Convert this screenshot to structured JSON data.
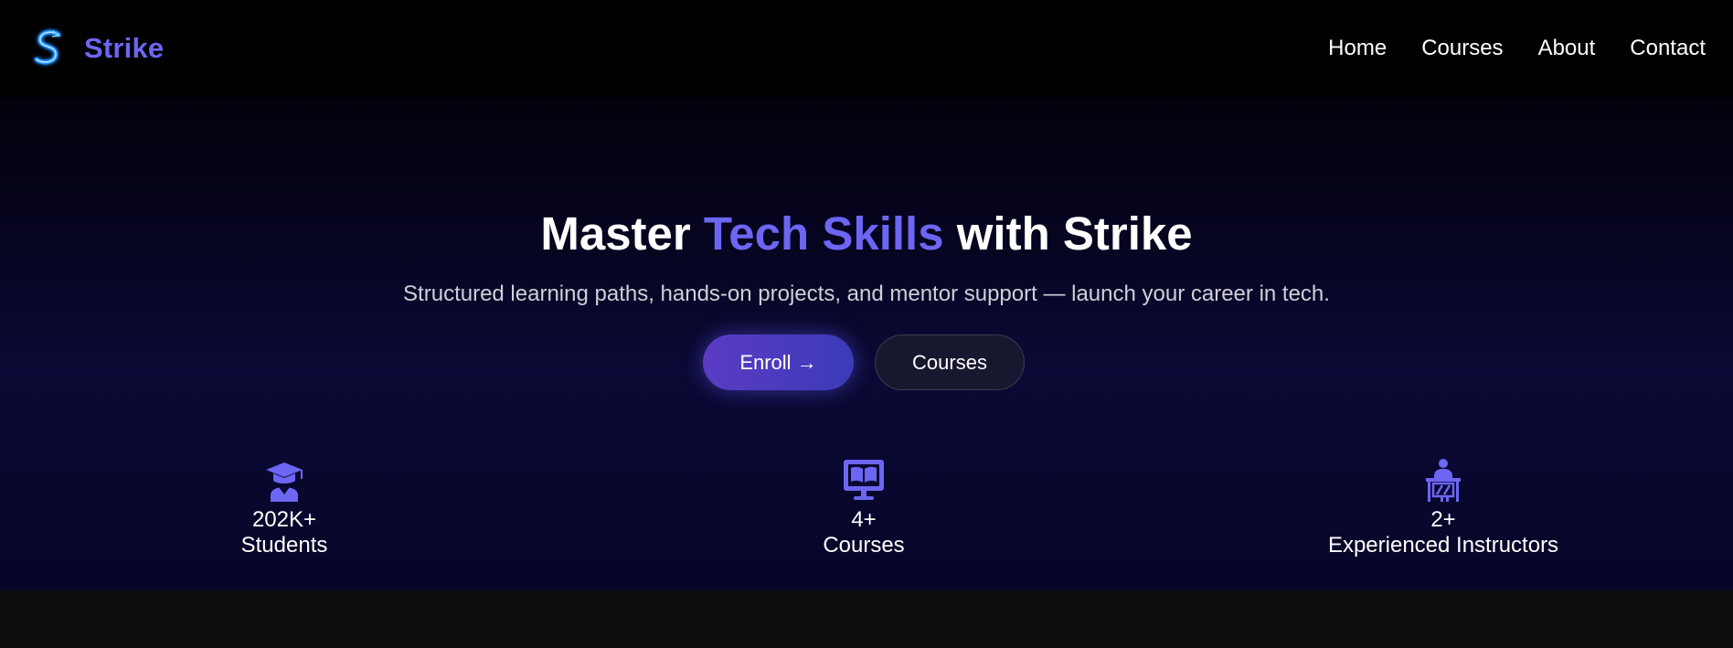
{
  "brand": {
    "name": "Strike",
    "logo_icon": "lightning-s-logo"
  },
  "nav": {
    "links": [
      "Home",
      "Courses",
      "About",
      "Contact"
    ]
  },
  "hero": {
    "title_prefix": "Master ",
    "title_accent": "Tech Skills",
    "title_suffix": " with Strike",
    "subtitle": "Structured learning paths, hands-on projects, and mentor support — launch your career in tech.",
    "primary_button": "Enroll →",
    "secondary_button": "Courses"
  },
  "stats": [
    {
      "icon": "graduation-cap-icon",
      "value": "202K+",
      "label": "Students"
    },
    {
      "icon": "monitor-book-icon",
      "value": "4+",
      "label": "Courses"
    },
    {
      "icon": "teacher-desk-icon",
      "value": "2+",
      "label": "Experienced Instructors"
    }
  ],
  "colors": {
    "accent": "#6c66f3",
    "nav_bg": "#000000",
    "button_gradient_start": "#5b3bc4",
    "button_gradient_end": "#3c3bb8"
  }
}
